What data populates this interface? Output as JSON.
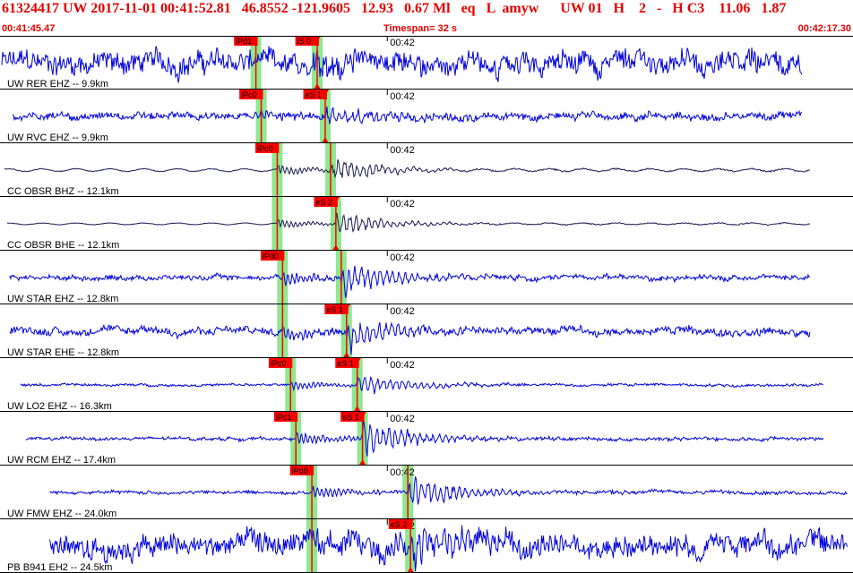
{
  "header": {
    "title": "61324417 UW 2017-11-01 00:41:52.81   46.8552 -121.9605   12.93   0.67 Ml   eq   L  amyw      UW 01   H    2   -   H C3    11.06   1.87",
    "start_time": "00:41:45.47",
    "timespan": "Timespan=  32 s",
    "end_time": "00:42:17.30"
  },
  "colors": {
    "header_text": "#e60000",
    "trace_blue": "#0000e0",
    "trace_dark": "#1a1a50",
    "pick_red": "#ff0000",
    "highlight_green": "#8ee88e",
    "divider": "#000000"
  },
  "chart_data": {
    "type": "seismogram",
    "time_start": "00:41:45.47",
    "time_end": "00:42:17.30",
    "timespan_s": 32,
    "minute_label": "00:42",
    "traces": [
      {
        "label": "UW RER EHZ -- 9.9km",
        "color": "blue",
        "p_pick": "iPd1",
        "s_pick": "iS 0",
        "p_t": 9.6,
        "s_t": 11.9,
        "start_t": 0.0,
        "end_t": 30.1,
        "amp": 0.28,
        "noise": 0.55
      },
      {
        "label": "UW RVC EHZ -- 9.9km",
        "color": "blue",
        "p_pick": "iPc0",
        "s_pick": "eS 1",
        "p_t": 9.8,
        "s_t": 12.2,
        "start_t": 0.4,
        "end_t": 30.1,
        "amp": 0.35,
        "noise": 0.18
      },
      {
        "label": "CC OBSR BHZ -- 12.1km",
        "color": "dark",
        "p_pick": "iPc0",
        "s_pick": "",
        "p_t": 10.4,
        "s_t": 12.4,
        "start_t": 0.1,
        "end_t": 30.4,
        "amp": 0.45,
        "noise": 0.08
      },
      {
        "label": "CC OBSR BHE -- 12.1km",
        "color": "dark",
        "p_pick": "",
        "s_pick": "eS 2",
        "p_t": 10.4,
        "s_t": 12.6,
        "start_t": 0.2,
        "end_t": 30.4,
        "amp": 0.4,
        "noise": 0.05
      },
      {
        "label": "UW STAR EHZ -- 12.8km",
        "color": "blue",
        "p_pick": "iPd0",
        "s_pick": "",
        "p_t": 10.6,
        "s_t": 12.8,
        "start_t": 0.3,
        "end_t": 30.4,
        "amp": 0.6,
        "noise": 0.12
      },
      {
        "label": "UW STAR EHE -- 12.8km",
        "color": "blue",
        "p_pick": "",
        "s_pick": "eS 1",
        "p_t": 10.6,
        "s_t": 13.0,
        "start_t": 0.3,
        "end_t": 30.4,
        "amp": 0.55,
        "noise": 0.18
      },
      {
        "label": "UW LO2 EHZ -- 16.3km",
        "color": "blue",
        "p_pick": "iPc0",
        "s_pick": "eS 1",
        "p_t": 10.9,
        "s_t": 13.4,
        "start_t": 0.7,
        "end_t": 30.9,
        "amp": 0.4,
        "noise": 0.06
      },
      {
        "label": "UW RCM EHZ -- 17.4km",
        "color": "blue",
        "p_pick": "iPc1",
        "s_pick": "eS 1",
        "p_t": 11.1,
        "s_t": 13.6,
        "start_t": 0.9,
        "end_t": 30.9,
        "amp": 0.65,
        "noise": 0.08
      },
      {
        "label": "UW FMW EHZ -- 24.0km",
        "color": "blue",
        "p_pick": "iPd0",
        "s_pick": "",
        "p_t": 11.7,
        "s_t": 15.3,
        "start_t": 1.8,
        "end_t": 31.8,
        "amp": 0.6,
        "noise": 0.08
      },
      {
        "label": "PB B941 EH2 -- 24.5km",
        "color": "blue",
        "p_pick": "",
        "s_pick": "eS 2",
        "p_t": 11.7,
        "s_t": 15.4,
        "start_t": 1.8,
        "end_t": 31.8,
        "amp": 0.75,
        "noise": 0.55
      }
    ]
  }
}
